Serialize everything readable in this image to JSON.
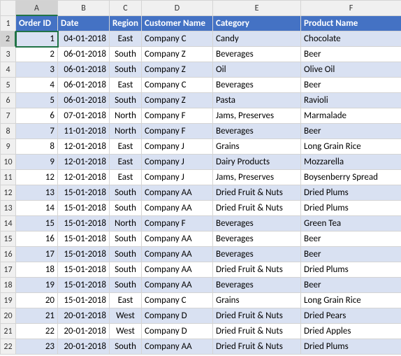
{
  "columns": [
    "A",
    "B",
    "C",
    "D",
    "E",
    "F"
  ],
  "rowNumbers": [
    1,
    2,
    3,
    4,
    5,
    6,
    7,
    8,
    9,
    10,
    11,
    12,
    13,
    14,
    15,
    16,
    17,
    18,
    19,
    20,
    21,
    22
  ],
  "headerRow": {
    "orderId": "Order ID",
    "date": "Date",
    "region": "Region",
    "customer": "Customer Name",
    "category": "Category",
    "product": "Product Name"
  },
  "activeCell": {
    "row": 2,
    "col": "A"
  },
  "rows": [
    {
      "orderId": 1,
      "date": "04-01-2018",
      "region": "East",
      "customer": "Company C",
      "category": "Candy",
      "product": "Chocolate"
    },
    {
      "orderId": 2,
      "date": "06-01-2018",
      "region": "South",
      "customer": "Company Z",
      "category": "Beverages",
      "product": "Beer"
    },
    {
      "orderId": 3,
      "date": "06-01-2018",
      "region": "South",
      "customer": "Company Z",
      "category": "Oil",
      "product": "Olive Oil"
    },
    {
      "orderId": 4,
      "date": "06-01-2018",
      "region": "East",
      "customer": "Company C",
      "category": "Beverages",
      "product": "Beer"
    },
    {
      "orderId": 5,
      "date": "06-01-2018",
      "region": "South",
      "customer": "Company Z",
      "category": "Pasta",
      "product": "Ravioli"
    },
    {
      "orderId": 6,
      "date": "07-01-2018",
      "region": "North",
      "customer": "Company F",
      "category": "Jams, Preserves",
      "product": "Marmalade"
    },
    {
      "orderId": 7,
      "date": "11-01-2018",
      "region": "North",
      "customer": "Company F",
      "category": "Beverages",
      "product": "Beer"
    },
    {
      "orderId": 8,
      "date": "12-01-2018",
      "region": "East",
      "customer": "Company J",
      "category": "Grains",
      "product": "Long Grain Rice"
    },
    {
      "orderId": 9,
      "date": "12-01-2018",
      "region": "East",
      "customer": "Company J",
      "category": "Dairy Products",
      "product": "Mozzarella"
    },
    {
      "orderId": 12,
      "date": "12-01-2018",
      "region": "East",
      "customer": "Company J",
      "category": "Jams, Preserves",
      "product": "Boysenberry Spread"
    },
    {
      "orderId": 13,
      "date": "15-01-2018",
      "region": "South",
      "customer": "Company AA",
      "category": "Dried Fruit & Nuts",
      "product": "Dried Plums"
    },
    {
      "orderId": 14,
      "date": "15-01-2018",
      "region": "South",
      "customer": "Company AA",
      "category": "Dried Fruit & Nuts",
      "product": "Dried Plums"
    },
    {
      "orderId": 15,
      "date": "15-01-2018",
      "region": "North",
      "customer": "Company F",
      "category": "Beverages",
      "product": "Green Tea"
    },
    {
      "orderId": 16,
      "date": "15-01-2018",
      "region": "South",
      "customer": "Company AA",
      "category": "Beverages",
      "product": "Beer"
    },
    {
      "orderId": 17,
      "date": "15-01-2018",
      "region": "South",
      "customer": "Company AA",
      "category": "Beverages",
      "product": "Beer"
    },
    {
      "orderId": 18,
      "date": "15-01-2018",
      "region": "South",
      "customer": "Company AA",
      "category": "Dried Fruit & Nuts",
      "product": "Dried Plums"
    },
    {
      "orderId": 19,
      "date": "15-01-2018",
      "region": "South",
      "customer": "Company AA",
      "category": "Beverages",
      "product": "Beer"
    },
    {
      "orderId": 20,
      "date": "15-01-2018",
      "region": "East",
      "customer": "Company C",
      "category": "Grains",
      "product": "Long Grain Rice"
    },
    {
      "orderId": 21,
      "date": "20-01-2018",
      "region": "West",
      "customer": "Company D",
      "category": "Dried Fruit & Nuts",
      "product": "Dried Pears"
    },
    {
      "orderId": 22,
      "date": "20-01-2018",
      "region": "West",
      "customer": "Company D",
      "category": "Dried Fruit & Nuts",
      "product": "Dried Apples"
    },
    {
      "orderId": 23,
      "date": "20-01-2018",
      "region": "South",
      "customer": "Company AA",
      "category": "Dried Fruit & Nuts",
      "product": "Dried Plums"
    }
  ]
}
